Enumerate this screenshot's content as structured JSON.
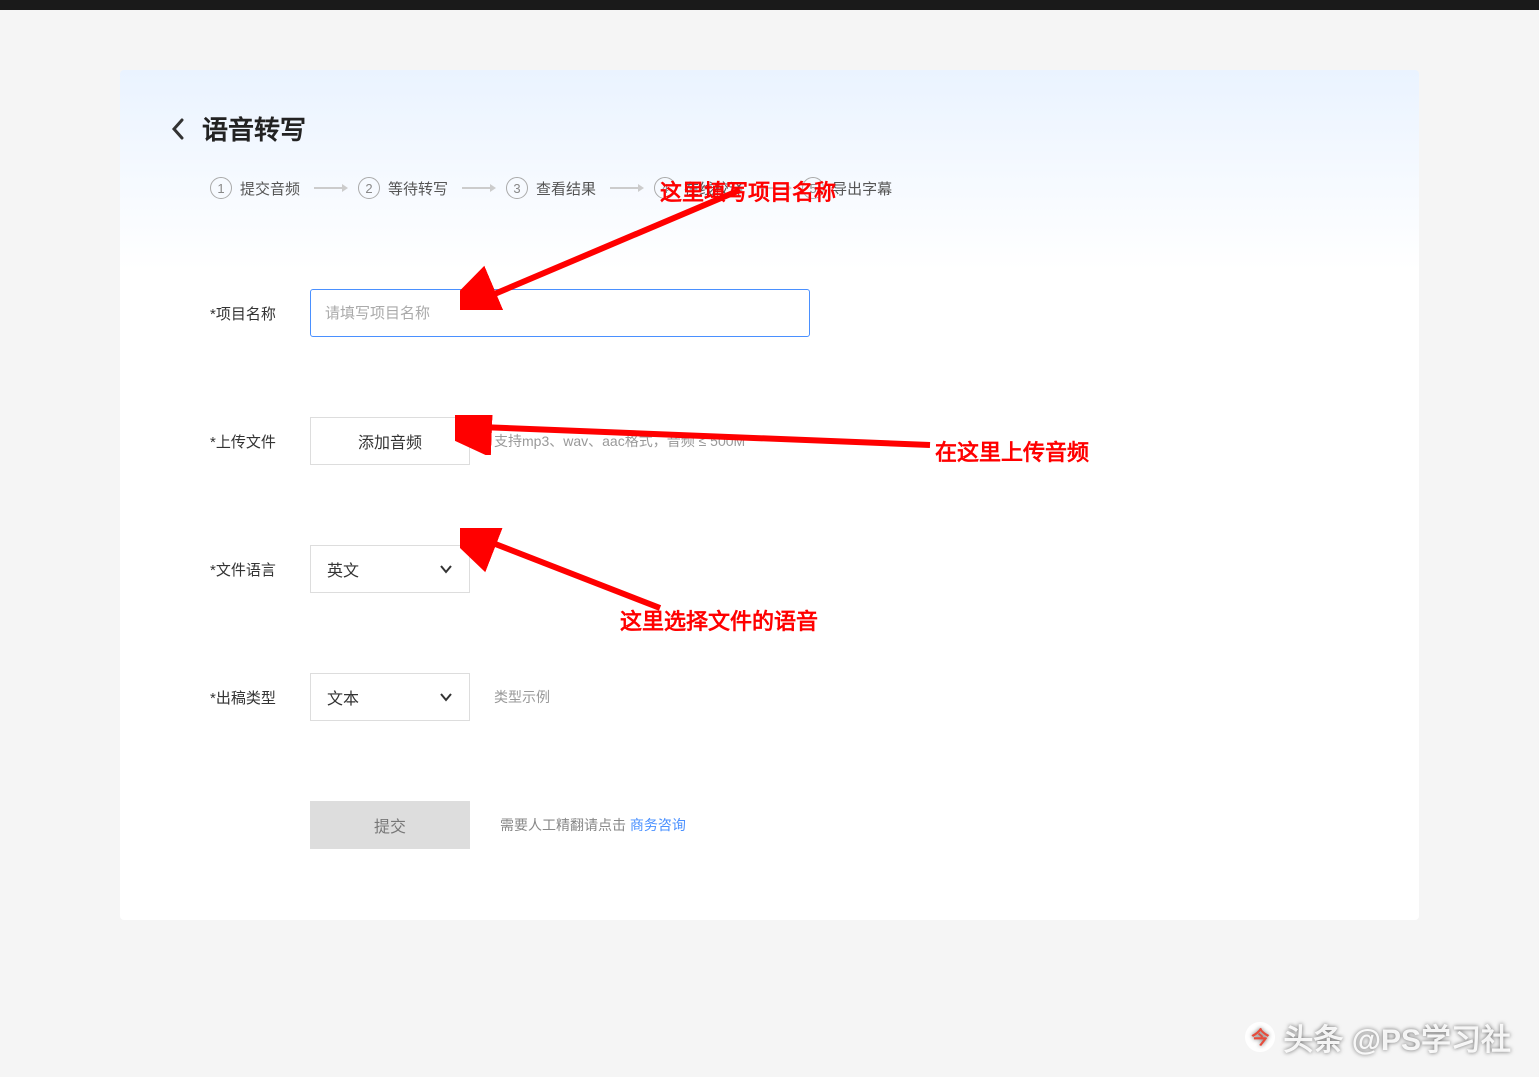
{
  "page": {
    "title": "语音转写"
  },
  "steps": [
    {
      "num": "1",
      "label": "提交音频"
    },
    {
      "num": "2",
      "label": "等待转写"
    },
    {
      "num": "3",
      "label": "查看结果"
    },
    {
      "num": "4",
      "label": "在线校译"
    },
    {
      "num": "5",
      "label": "导出字幕"
    }
  ],
  "form": {
    "project_name": {
      "label": "*项目名称",
      "placeholder": "请填写项目名称",
      "value": ""
    },
    "upload": {
      "label": "*上传文件",
      "button": "添加音频",
      "hint": "支持mp3、wav、aac格式，音频 ≤ 500M"
    },
    "language": {
      "label": "*文件语言",
      "selected": "英文"
    },
    "output_type": {
      "label": "*出稿类型",
      "selected": "文本",
      "hint": "类型示例"
    },
    "submit": {
      "button": "提交",
      "hint_prefix": "需要人工精翻请点击 ",
      "hint_link": "商务咨询"
    }
  },
  "annotations": {
    "a1": "这里填写项目名称",
    "a2": "在这里上传音频",
    "a3": "这里选择文件的语音"
  },
  "watermark": "头条 @PS学习社"
}
